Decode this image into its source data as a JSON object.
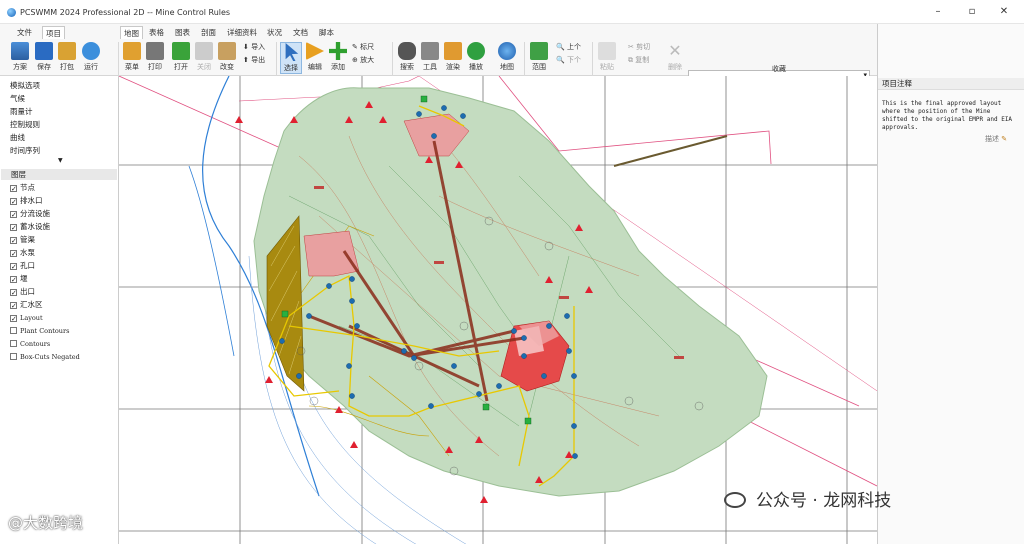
{
  "window": {
    "title": "PCSWMM 2024 Professional 2D -- Mine Control Rules"
  },
  "left_tabs": [
    "文件",
    "项目"
  ],
  "main_tabs": [
    "地图",
    "表格",
    "图表",
    "剖面",
    "详细资料",
    "状况",
    "文档",
    "脚本"
  ],
  "right_tabs": [
    "属性",
    "注释"
  ],
  "project_buttons": [
    "方案",
    "保存",
    "打包",
    "运行"
  ],
  "map_buttons": {
    "menu": "菜单",
    "print": "打印",
    "open": "打开",
    "close": "关闭",
    "change": "改变",
    "import": "导入",
    "export": "导出",
    "select": "选择",
    "edit": "编辑",
    "add": "添加",
    "add2": "添加",
    "ruler": "标尺",
    "zoom_in": "放大",
    "search": "搜索",
    "tools": "工具",
    "render": "渲染",
    "play": "播放",
    "map": "地图",
    "range": "范围",
    "up": "上个",
    "down": "下个",
    "paste": "粘贴",
    "cut": "剪切",
    "copy": "复制",
    "delete": "删除",
    "favorites": "收藏"
  },
  "right_buttons": [
    "搜索",
    "添加",
    "粘贴",
    "删除"
  ],
  "nav_items": [
    "模拟选项",
    "气候",
    "雨量计",
    "控制规则",
    "曲线",
    "时间序列"
  ],
  "layers_header": "图层",
  "layers": [
    {
      "label": "节点",
      "checked": true
    },
    {
      "label": "排水口",
      "checked": true
    },
    {
      "label": "分流设施",
      "checked": true
    },
    {
      "label": "蓄水设施",
      "checked": true
    },
    {
      "label": "管渠",
      "checked": true
    },
    {
      "label": "水泵",
      "checked": true
    },
    {
      "label": "孔口",
      "checked": true
    },
    {
      "label": "堰",
      "checked": true
    },
    {
      "label": "出口",
      "checked": true
    },
    {
      "label": "汇水区",
      "checked": true
    },
    {
      "label": "Layout",
      "checked": true
    },
    {
      "label": "Plant Contours",
      "checked": false
    },
    {
      "label": "Contours",
      "checked": false
    },
    {
      "label": "Box-Cuts Negated",
      "checked": false
    }
  ],
  "notes": {
    "header": "项目注释",
    "text": "This is the final approved layout where the position of the Mine shifted to the original EMPR and EIA approvals.",
    "describe": "描述"
  },
  "watermark": {
    "main": "公众号 · 龙网科技",
    "corner": "@大数跨境"
  },
  "colors": {
    "accent": "#1a7fd6",
    "area": "#c4dcc0",
    "conduit": "#8a2b1a",
    "pond": "#e8a0a0",
    "node": "#1d6cb0"
  }
}
